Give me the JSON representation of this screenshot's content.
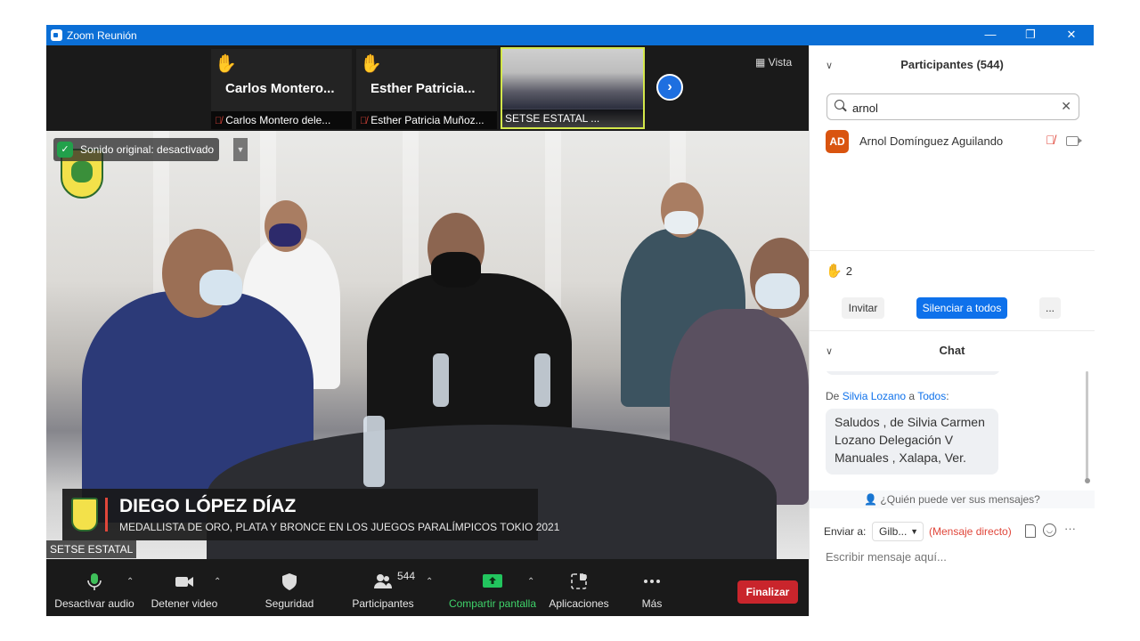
{
  "window": {
    "title": "Zoom Reunión",
    "controls": {
      "minimize": "—",
      "restore": "❐",
      "close": "✕"
    },
    "accent": "#0b6fd6"
  },
  "strip": {
    "tiles": [
      {
        "big": "Carlos  Montero...",
        "name": "Carlos Montero dele..."
      },
      {
        "big": "Esther  Patricia...",
        "name": "Esther Patricia Muñoz..."
      }
    ],
    "active_tile": {
      "name": "SETSE ESTATAL ..."
    },
    "vista_label": "Vista"
  },
  "main_video": {
    "sound_badge": "Sonido original: desactivado",
    "lower_third": {
      "name": "DIEGO LÓPEZ DÍAZ",
      "subtitle": "MEDALLISTA DE ORO, PLATA Y BRONCE EN LOS JUEGOS PARALÍMPICOS TOKIO 2021"
    },
    "speaker_label": "SETSE ESTATAL"
  },
  "toolbar": {
    "mute": "Desactivar audio",
    "video": "Detener video",
    "security": "Seguridad",
    "participants": "Participantes",
    "participants_count": "544",
    "share": "Compartir pantalla",
    "apps": "Aplicaciones",
    "more": "Más",
    "end": "Finalizar",
    "end_color": "#c9252c",
    "share_color": "#22c55e"
  },
  "panel": {
    "participants_title": "Participantes (544)",
    "search_value": "arnol",
    "participant": {
      "initials": "AD",
      "name": "Arnol Domínguez Aguilando"
    },
    "raised_hands": "2",
    "invite": "Invitar",
    "mute_all": "Silenciar a todos",
    "more": "...",
    "chat_title": "Chat",
    "message": {
      "from_prefix": "De ",
      "from": "Silvia Lozano",
      "to_prefix": " a ",
      "to": "Todos",
      "to_suffix": ":",
      "text": "Saludos , de Silvia Carmen Lozano Delegación V Manuales , Xalapa, Ver."
    },
    "who_sees": "¿Quién puede ver sus mensajes?",
    "send_to_label": "Enviar a:",
    "send_to_value": "Gilb...",
    "direct": "(Mensaje directo)",
    "input_placeholder": "Escribir mensaje aquí..."
  }
}
